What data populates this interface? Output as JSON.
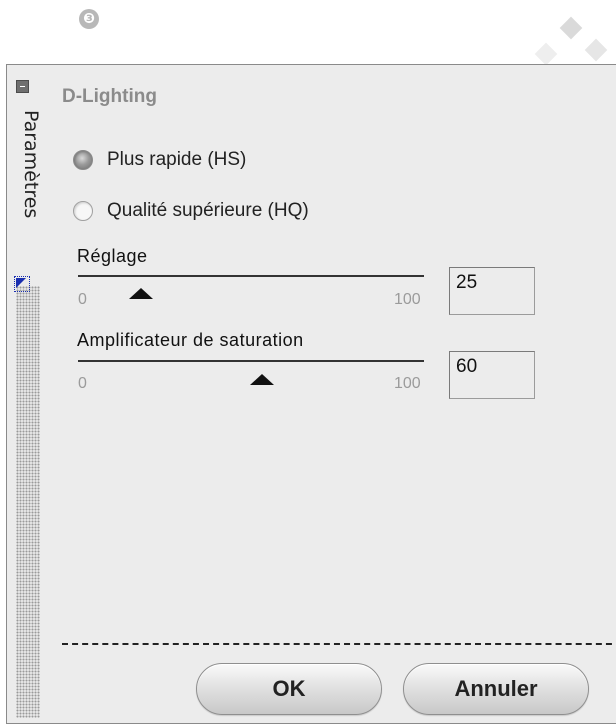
{
  "step_marker": "❸",
  "side_tab": {
    "label": "Paramètres"
  },
  "panel": {
    "title": "D-Lighting"
  },
  "mode_options": [
    {
      "label": "Plus rapide (HS)",
      "selected": true
    },
    {
      "label": "Qualité supérieure (HQ)",
      "selected": false
    }
  ],
  "sliders": [
    {
      "label": "Réglage",
      "min_label": "0",
      "max_label": "100",
      "value": 25
    },
    {
      "label": "Amplificateur de saturation",
      "min_label": "0",
      "max_label": "100",
      "value": 60
    }
  ],
  "buttons": {
    "ok": "OK",
    "cancel": "Annuler"
  },
  "colors": {
    "panel_bg": "#ececec",
    "title": "#8b8b8b",
    "accent_marker": "#1a2fb0"
  }
}
